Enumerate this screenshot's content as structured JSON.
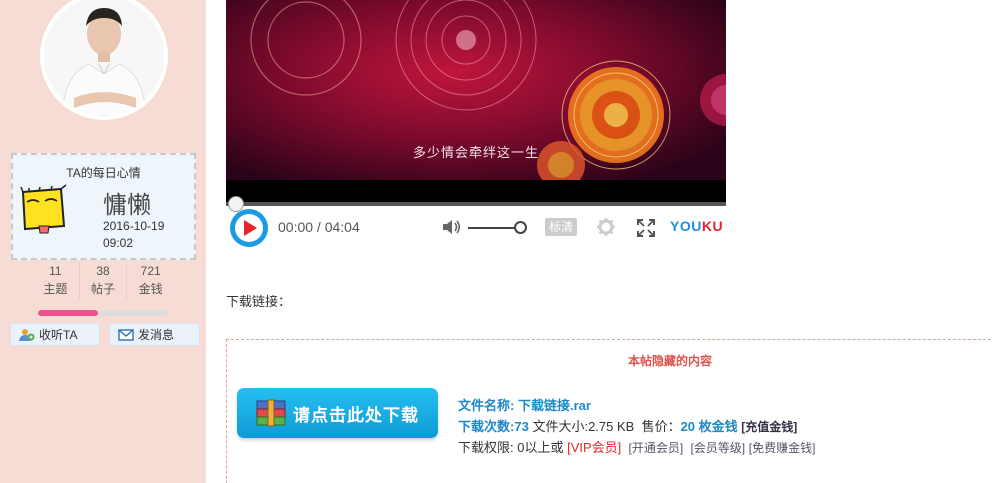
{
  "sidebar": {
    "mood": {
      "title": "TA的每日心情",
      "word": "慵懒",
      "date": "2016-10-19",
      "time": "09:02"
    },
    "stats": [
      {
        "value": "11",
        "label": "主题"
      },
      {
        "value": "38",
        "label": "帖子"
      },
      {
        "value": "721",
        "label": "金钱"
      }
    ],
    "level_progress": 0.46,
    "follow_label": "收听TA",
    "message_label": "发消息"
  },
  "video": {
    "subtitle": "多少情会牵绊这一生",
    "time_display": "00:00 / 04:04",
    "hd_label": "标清",
    "brand": "YOUKU",
    "volume_level": 0.9,
    "played_fraction": 0.0
  },
  "download": {
    "label": "下载链接：",
    "hidden_title": "本帖隐藏的内容",
    "button_label": "请点击此处下载",
    "file_name_label": "文件名称:",
    "file_name": "下载链接.rar",
    "count_label": "下载次数:",
    "count": "73",
    "size_label": "文件大小:",
    "size": "2.75 KB",
    "price_label": "售价：",
    "price": "20 枚金钱",
    "recharge": "[充值金钱]",
    "permission_label": "下载权限:",
    "permission_value": "0以上或",
    "vip": "[VIP会员]",
    "links": [
      "[开通会员]",
      "[会员等级]",
      "[免费赚金钱]"
    ]
  },
  "colors": {
    "sidebar_bg": "#f6dcd4",
    "accent_blue": "#1e88c8",
    "hidden_red": "#e0534c",
    "level_pink": "#f0508d"
  }
}
